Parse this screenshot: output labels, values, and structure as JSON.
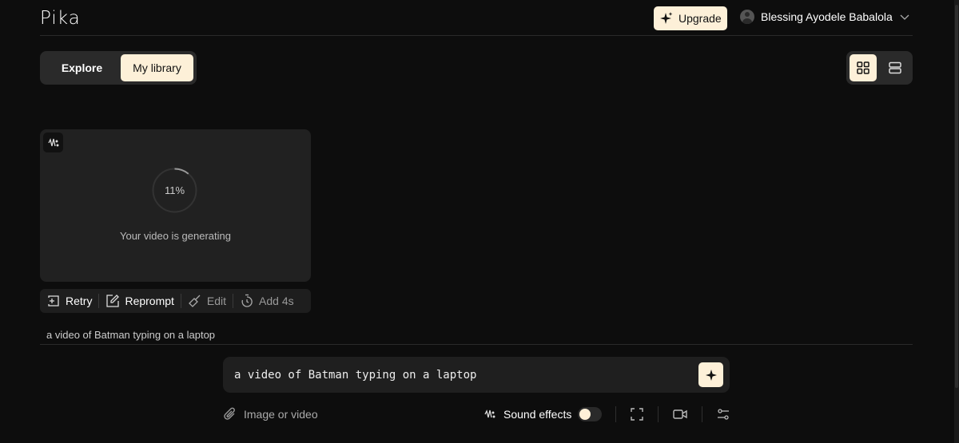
{
  "header": {
    "logo": "Pika",
    "upgrade_label": "Upgrade",
    "user_name": "Blessing Ayodele Babalola"
  },
  "tabs": [
    {
      "label": "Explore",
      "active": false
    },
    {
      "label": "My library",
      "active": true
    }
  ],
  "view_modes": [
    {
      "icon": "grid-icon",
      "active": true
    },
    {
      "icon": "list-icon",
      "active": false
    }
  ],
  "card": {
    "progress_percent": 11,
    "progress_label": "11%",
    "status": "Your video is generating",
    "caption": "a video of Batman typing on a laptop"
  },
  "actions": [
    {
      "label": "Retry",
      "icon": "retry-icon",
      "enabled": true
    },
    {
      "label": "Reprompt",
      "icon": "edit-pencil-icon",
      "enabled": true
    },
    {
      "label": "Edit",
      "icon": "brush-icon",
      "enabled": false
    },
    {
      "label": "Add 4s",
      "icon": "timer-icon",
      "enabled": false
    }
  ],
  "prompt": {
    "value": "a video of Batman typing on a laptop"
  },
  "toolbar": {
    "attach_label": "Image or video",
    "sound_label": "Sound effects",
    "sound_on": false
  },
  "colors": {
    "accent": "#fdf0d8",
    "background": "#0d0d0d",
    "card": "#212121"
  }
}
